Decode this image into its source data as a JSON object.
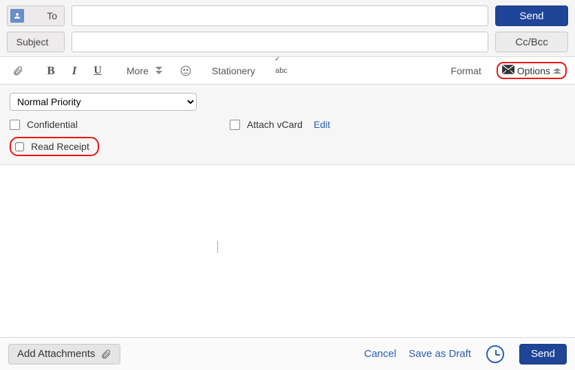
{
  "header": {
    "to_label": "To",
    "to_value": "",
    "subject_label": "Subject",
    "subject_value": "",
    "send_label": "Send",
    "ccbcc_label": "Cc/Bcc"
  },
  "toolbar": {
    "bold": "B",
    "italic": "I",
    "underline": "U",
    "more_label": "More",
    "stationery_label": "Stationery",
    "abc_label": "abc",
    "format_label": "Format",
    "options_label": "Options"
  },
  "options": {
    "priority_selected": "Normal Priority",
    "confidential_label": "Confidential",
    "read_receipt_label": "Read Receipt",
    "attach_vcard_label": "Attach vCard",
    "edit_label": "Edit"
  },
  "footer": {
    "add_attachments_label": "Add Attachments",
    "cancel_label": "Cancel",
    "save_draft_label": "Save as Draft",
    "send_label": "Send"
  }
}
